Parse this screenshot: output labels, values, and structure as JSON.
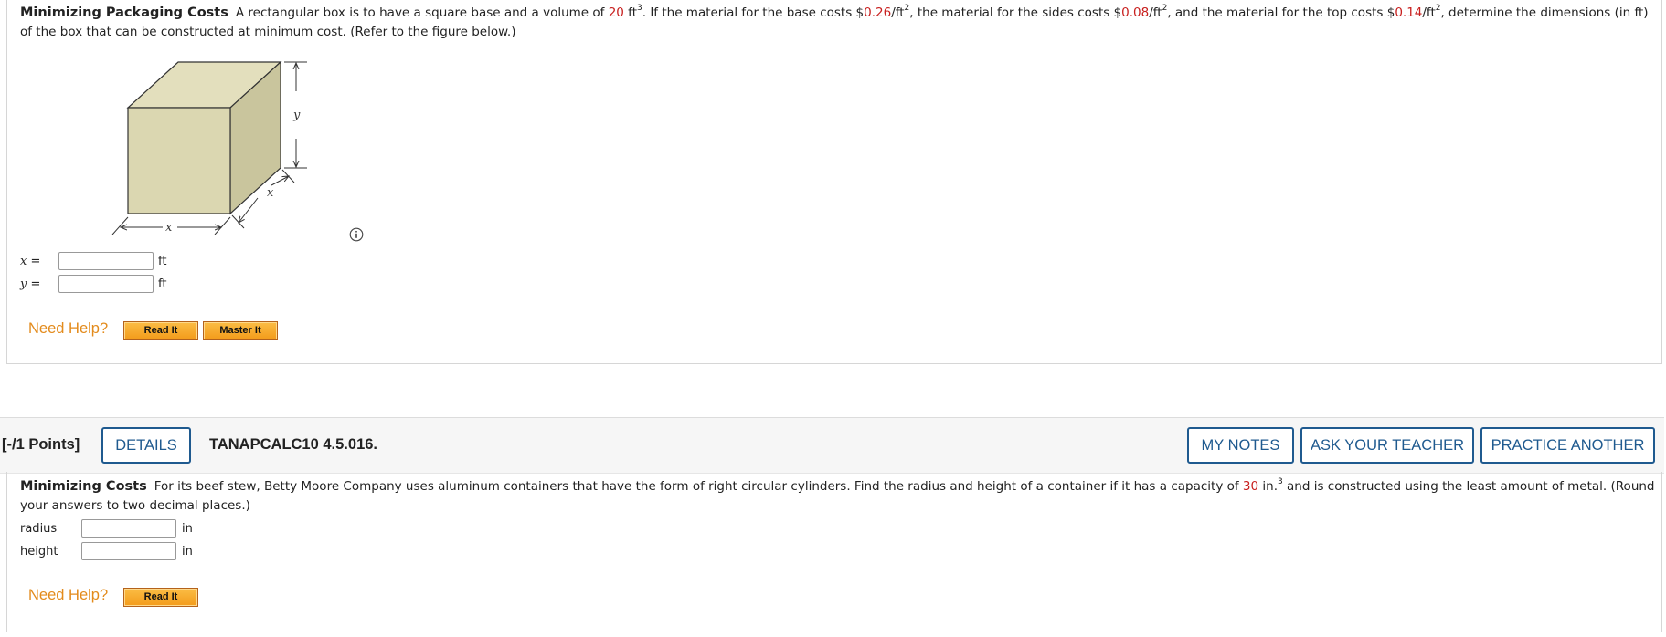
{
  "q1": {
    "title": "Minimizing Packaging Costs",
    "t1": "A rectangular box is to have a square base and a volume of ",
    "volume": "20",
    "t2": " ft",
    "t2_sup": "3",
    "t3": ". If the material for the base costs $",
    "base_cost": "0.26",
    "t4": "/ft",
    "t4_sup": "2",
    "t5": ", the material for the sides costs $",
    "side_cost": "0.08",
    "t6": "/ft",
    "t6_sup": "2",
    "t7": ", and the material for the top costs $",
    "top_cost": "0.14",
    "t8": "/ft",
    "t8_sup": "2",
    "t9": ", determine the dimensions (in ft) of the box that can be constructed at minimum cost. (Refer to the figure below.)",
    "figure": {
      "x_label": "x",
      "depth_label": "x",
      "y_label": "y"
    },
    "answers": [
      {
        "var": "x",
        "eq": "=",
        "value": "",
        "unit": "ft"
      },
      {
        "var": "y",
        "eq": "=",
        "value": "",
        "unit": "ft"
      }
    ],
    "need_help": "Need Help?",
    "read_it": "Read It",
    "master_it": "Master It"
  },
  "q2_header": {
    "points": "[-/1 Points]",
    "details": "DETAILS",
    "code": "TANAPCALC10 4.5.016.",
    "my_notes": "MY NOTES",
    "ask_teacher": "ASK YOUR TEACHER",
    "practice_another": "PRACTICE ANOTHER"
  },
  "q2": {
    "title": "Minimizing Costs",
    "t1": "For its beef stew, Betty Moore Company uses aluminum containers that have the form of right circular cylinders. Find the radius and height of a container if it has a capacity of ",
    "capacity": "30",
    "t2": " in.",
    "t2_sup": "3",
    "t3": " and is constructed using the least amount of metal. (Round your answers to two decimal places.)",
    "answers": [
      {
        "label": "radius",
        "value": "",
        "unit": "in"
      },
      {
        "label": "height",
        "value": "",
        "unit": "in"
      }
    ],
    "need_help": "Need Help?",
    "read_it": "Read It"
  },
  "colors": {
    "highlight_red": "#c8201f",
    "help_orange": "#e38b1c",
    "button_blue": "#1f5a8f",
    "box_front": "#dbd7b1",
    "box_top": "#e3dfbd",
    "box_side": "#c9c59d"
  },
  "icons": {
    "info": "info-circle-icon"
  }
}
